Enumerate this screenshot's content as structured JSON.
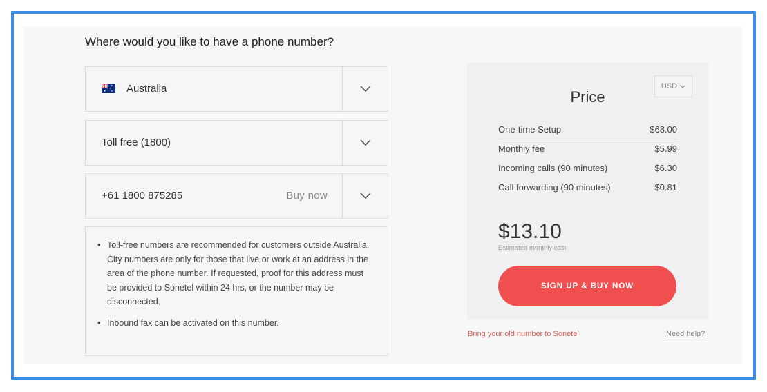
{
  "heading": "Where would you like to have a phone number?",
  "country_select": {
    "value": "Australia",
    "flag_icon": "australia-flag-icon"
  },
  "type_select": {
    "value": "Toll free (1800)"
  },
  "number_select": {
    "value": "+61 1800 875285",
    "action": "Buy now"
  },
  "info": {
    "items": [
      "Toll-free numbers are recommended for customers outside Australia.\nCity numbers are only for those that live or work at an address in the area of the phone number. If requested, proof for this address must be provided to Sonetel within 24 hrs, or the number may be disconnected.",
      "Inbound fax can be activated on this number."
    ]
  },
  "price": {
    "title": "Price",
    "currency": "USD",
    "rows": [
      {
        "label": "One-time Setup",
        "amount": "$68.00"
      },
      {
        "label": "Monthly fee",
        "amount": "$5.99"
      },
      {
        "label": "Incoming calls (90 minutes)",
        "amount": "$6.30"
      },
      {
        "label": "Call forwarding (90 minutes)",
        "amount": "$0.81"
      }
    ],
    "total": "$13.10",
    "total_caption": "Estimated monthly cost",
    "cta_label": "SIGN UP & BUY NOW"
  },
  "links": {
    "bring_number": "Bring your old number to Sonetel",
    "need_help": "Need help?"
  },
  "colors": {
    "accent": "#ef4f4f",
    "frame_border": "#3d8fe6",
    "link": "#e0615c"
  }
}
